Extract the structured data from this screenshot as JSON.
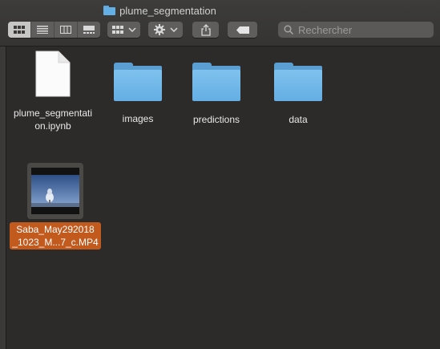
{
  "window": {
    "title": "plume_segmentation"
  },
  "toolbar": {
    "view_modes": [
      "icon-view",
      "list-view",
      "column-view",
      "gallery-view"
    ],
    "active_view": 0,
    "group_icon": "grid-icon",
    "action_icon": "gear-icon",
    "share_icon": "share-icon",
    "tag_icon": "tag-icon"
  },
  "search": {
    "placeholder": "Rechercher",
    "value": ""
  },
  "files": [
    {
      "name": "plume_segmentation.ipynb",
      "line1": "plume_segmentati",
      "line2": "on.ipynb",
      "kind": "document"
    },
    {
      "name": "images",
      "kind": "folder"
    },
    {
      "name": "predictions",
      "kind": "folder"
    },
    {
      "name": "data",
      "kind": "folder"
    },
    {
      "name": "Saba_May292018_1023_M...7_c.MP4",
      "line1": "Saba_May292018",
      "line2": "_1023_M...7_c.MP4",
      "kind": "video",
      "selected": true
    }
  ],
  "colors": {
    "accent": "#c2591d",
    "folder": "#64aee3",
    "background": "#2c2b29"
  }
}
